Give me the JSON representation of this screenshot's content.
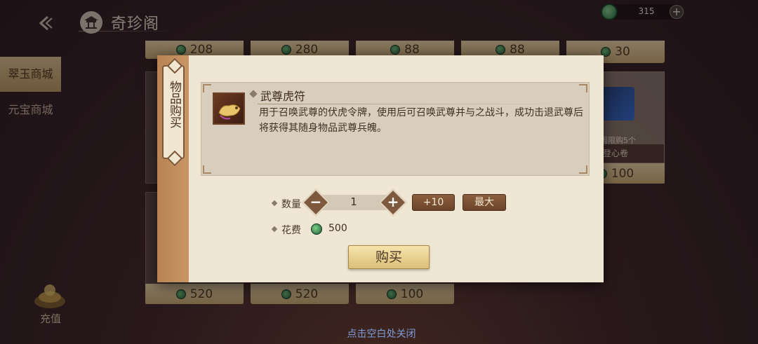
{
  "header": {
    "back_icon": "back-arrow-icon",
    "title": "奇珍阁",
    "currency": {
      "icon": "jade-coin-icon",
      "amount": "315",
      "add_icon": "plus-icon"
    }
  },
  "sidebar": {
    "items": [
      {
        "label": "翠玉商城",
        "active": true
      },
      {
        "label": "元宝商城",
        "active": false
      }
    ],
    "recharge_label": "充值"
  },
  "shop": {
    "top_row_prices": [
      "208",
      "280",
      "88",
      "88",
      "30"
    ],
    "middle_price": "100",
    "bottom_row_prices": [
      "520",
      "520",
      "100"
    ],
    "card_note": "周限购5个",
    "card_label": "登心卷"
  },
  "dialog": {
    "tab_title": "物品购买",
    "item": {
      "name": "武尊虎符",
      "description": "用于召唤武尊的伏虎令牌，使用后可召唤武尊并与之战斗，成功击退武尊后将获得其随身物品武尊兵魄。"
    },
    "quantity_label": "数量",
    "quantity": "1",
    "plus_ten_label": "+10",
    "max_label": "最大",
    "cost_label": "花费",
    "cost_value": "500",
    "buy_label": "购买"
  },
  "footer": {
    "close_hint": "点击空白处关闭"
  },
  "colors": {
    "jade": "#2f8a4c",
    "panel": "#efe6d4",
    "spine": "#c08c5c",
    "accent_gold": "#e6d3a7"
  }
}
